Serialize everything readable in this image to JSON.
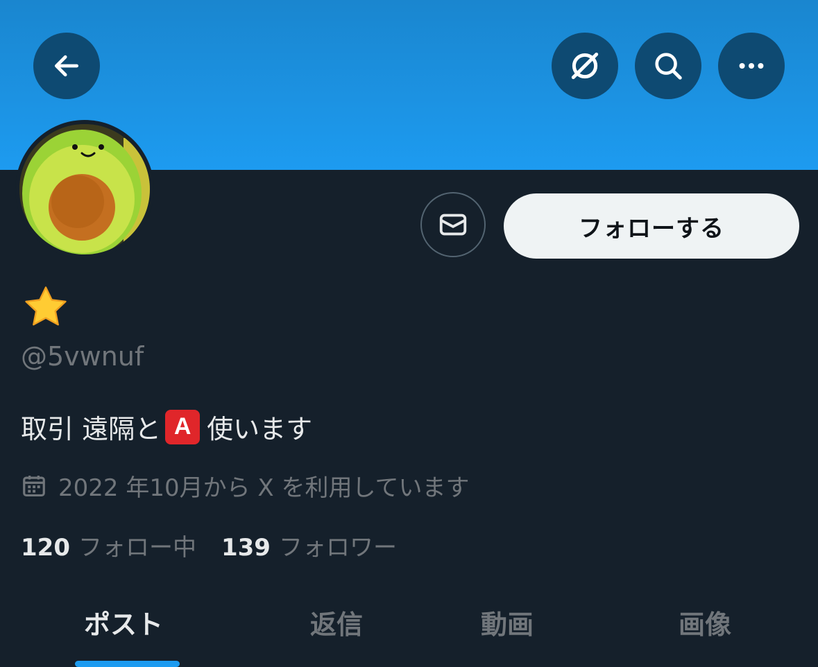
{
  "header": {
    "back_icon": "arrow-left-icon",
    "grok_icon": "grok-icon",
    "search_icon": "search-icon",
    "more_icon": "more-dots-icon",
    "banner_color": "#1d9bf0"
  },
  "profile": {
    "display_name_emoji": "⭐",
    "handle": "@5vwnuf",
    "bio_text_1": "取引 遠隔と",
    "bio_emoji": "A",
    "bio_text_2": "使います",
    "joined": "2022 年10月から X を利用しています",
    "following_count": "120",
    "following_label": "フォロー中",
    "followers_count": "139",
    "followers_label": "フォロワー"
  },
  "actions": {
    "message_icon": "envelope-icon",
    "follow_label": "フォローする"
  },
  "tabs": [
    {
      "label": "ポスト",
      "active": true
    },
    {
      "label": "返信",
      "active": false
    },
    {
      "label": "動画",
      "active": false
    },
    {
      "label": "画像",
      "active": false
    }
  ],
  "colors": {
    "background": "#15202b",
    "accent": "#1d9bf0",
    "muted_text": "#71767b"
  }
}
